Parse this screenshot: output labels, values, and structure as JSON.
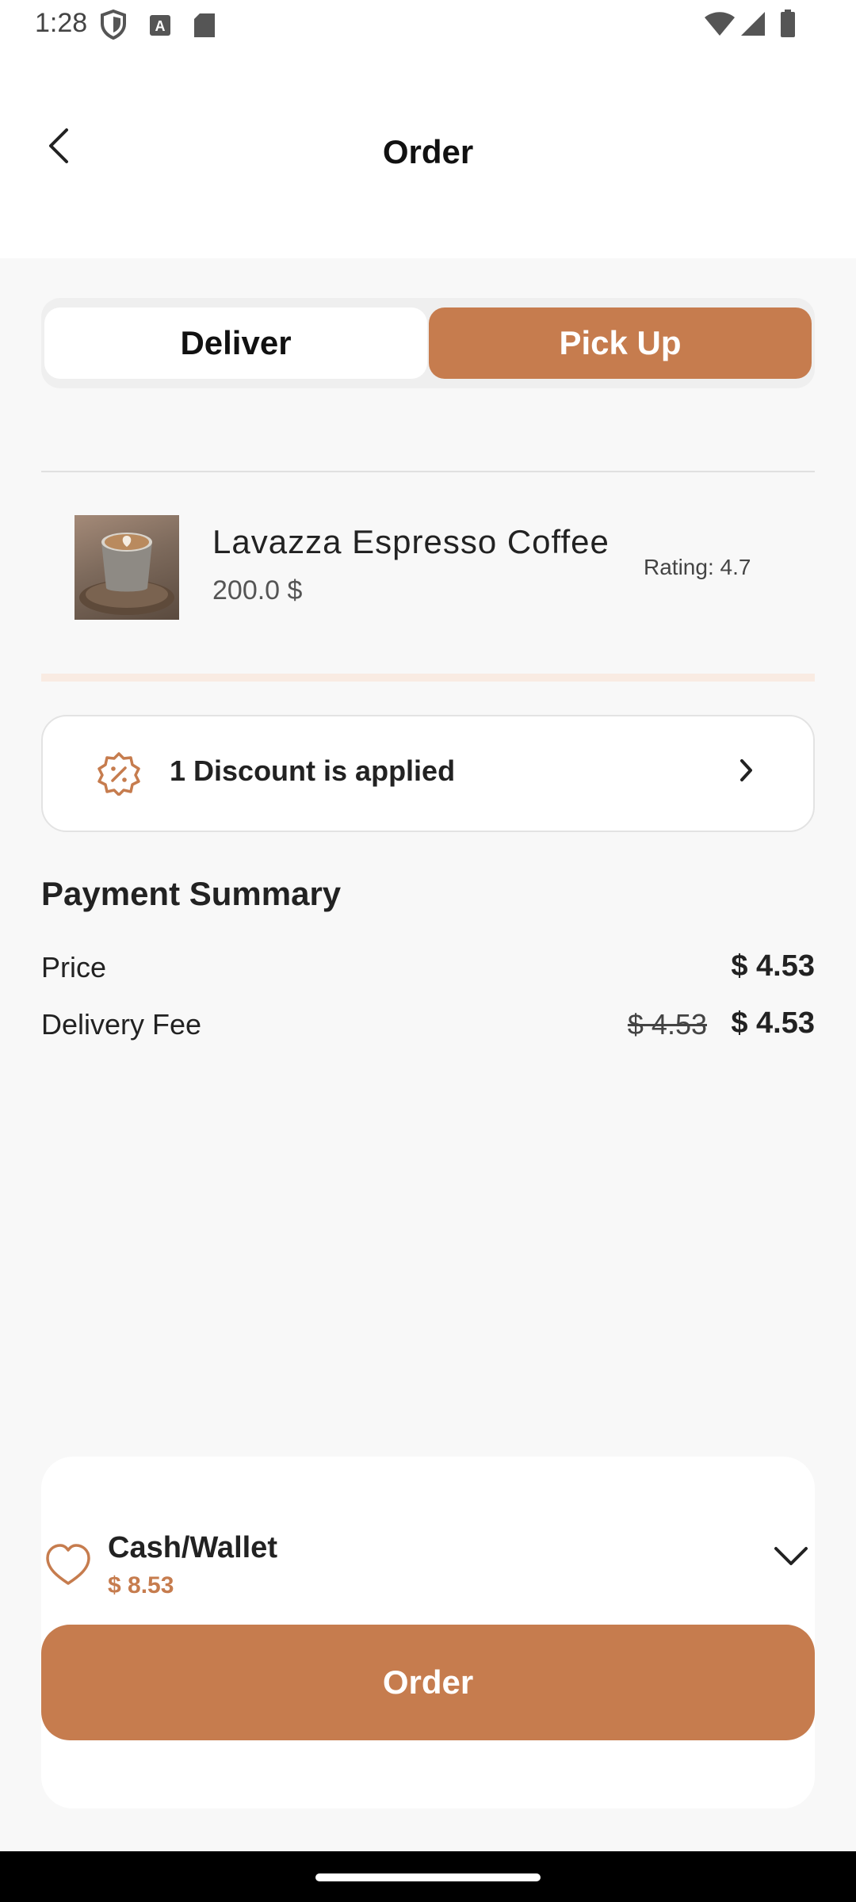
{
  "status_bar": {
    "time": "1:28",
    "left_icons": [
      "shield-icon",
      "text-a-icon",
      "sd-card-icon"
    ],
    "right_icons": [
      "wifi-icon",
      "signal-icon",
      "battery-icon"
    ]
  },
  "header": {
    "title": "Order",
    "back_icon": "chevron-left-icon"
  },
  "toggle": {
    "options": [
      "Deliver",
      "Pick Up"
    ],
    "selected": "Pick Up"
  },
  "product": {
    "name": "Lavazza Espresso Coffee",
    "price": "200.0 $",
    "rating": "Rating: 4.7"
  },
  "discount": {
    "text": "1 Discount is applied",
    "icon": "discount-badge-icon"
  },
  "payment_summary": {
    "title": "Payment Summary",
    "rows": [
      {
        "label": "Price",
        "value": "$ 4.53",
        "old_value": ""
      },
      {
        "label": "Delivery Fee",
        "value": "$ 4.53",
        "old_value": "$ 4.53"
      }
    ]
  },
  "wallet": {
    "name": "Cash/Wallet",
    "balance": "$ 8.53",
    "icon": "wallet-icon"
  },
  "order_button": {
    "label": "Order"
  },
  "colors": {
    "accent": "#c67c4e",
    "background": "#f8f8f8"
  }
}
